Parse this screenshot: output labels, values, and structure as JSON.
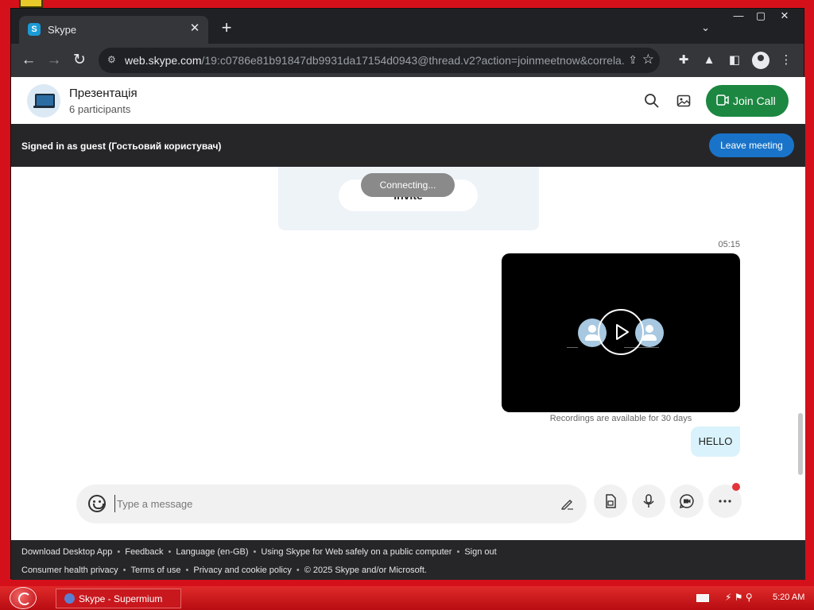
{
  "browser": {
    "tab_title": "Skype",
    "tab_favicon_letter": "S",
    "tab_close": "✕",
    "new_tab": "+",
    "url_host": "web.skype.com",
    "url_path": "/19:c0786e81b91847db9931da17154d0943@thread.v2?action=joinmeetnow&correla..."
  },
  "header": {
    "title": "Презентація",
    "subtitle": "6 participants",
    "join_call_label": "Join Call"
  },
  "guest_bar": {
    "text": "Signed in as guest (Гостьовий користувач)",
    "leave_label": "Leave meeting"
  },
  "chat": {
    "invite_label": "Invite",
    "connecting_label": "Connecting...",
    "timestamp": "05:15",
    "recording_note": "Recordings are available for 30 days",
    "message_text": "HELLO"
  },
  "composer": {
    "placeholder": "Type a message"
  },
  "footer": {
    "line1": [
      "Download Desktop App",
      "Feedback",
      "Language (en-GB)",
      "Using Skype for Web safely on a public computer",
      "Sign out"
    ],
    "line2": [
      "Consumer health privacy",
      "Terms of use",
      "Privacy and cookie policy",
      "© 2025 Skype and/or Microsoft."
    ]
  },
  "taskbar": {
    "window_label": "Skype - Supermium",
    "clock": "5:20 AM"
  },
  "colors": {
    "join_green": "#1c8741",
    "leave_blue": "#1974c9",
    "desktop_red": "#d4101a",
    "bubble_blue": "#d9f2fb"
  }
}
